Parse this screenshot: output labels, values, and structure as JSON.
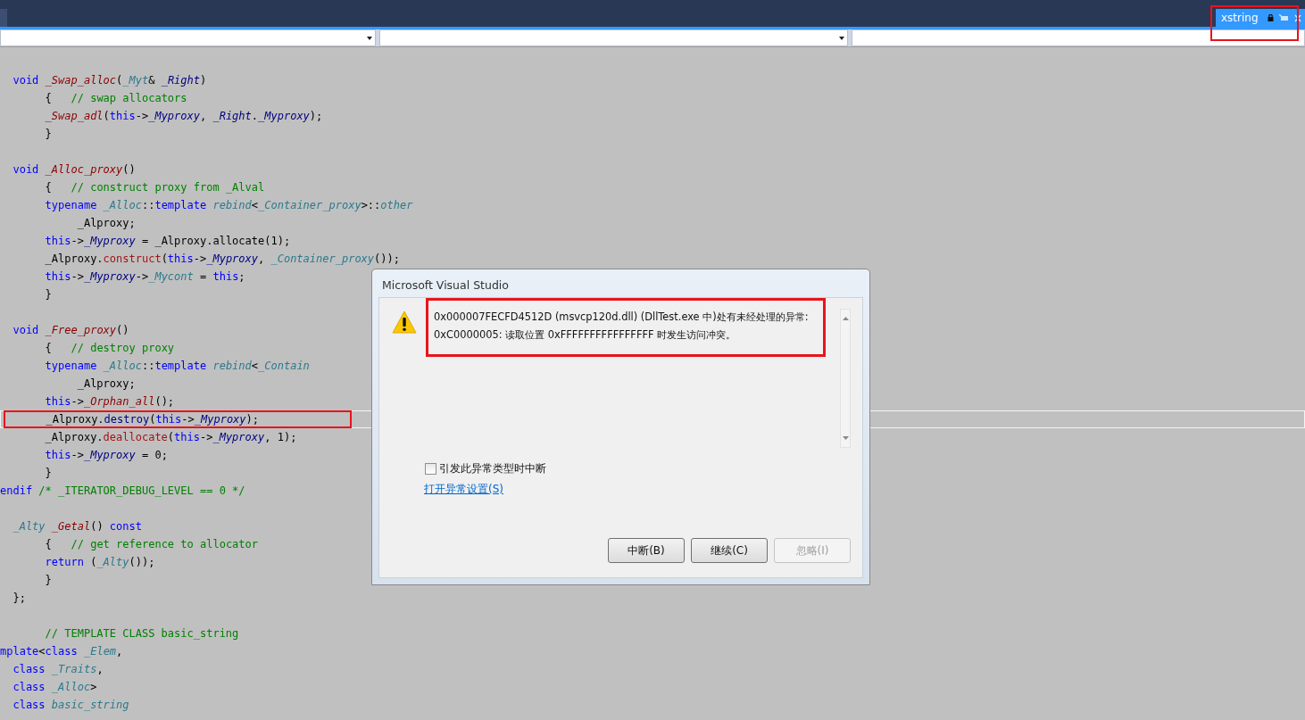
{
  "editor_tab": {
    "title": "xstring",
    "selected": true
  },
  "code_lines": [
    {
      "kind": "blank"
    },
    {
      "kind": "code",
      "tokens": [
        {
          "kind": "keyword",
          "text": "  void "
        },
        {
          "kind": "function",
          "text": "_Swap_alloc"
        },
        {
          "kind": "plain",
          "text": "("
        },
        {
          "kind": "type",
          "text": "_Myt"
        },
        {
          "kind": "plain",
          "text": "& "
        },
        {
          "kind": "field",
          "text": "_Right"
        },
        {
          "kind": "plain",
          "text": ")"
        }
      ]
    },
    {
      "kind": "code",
      "tokens": [
        {
          "kind": "plain",
          "text": "       {   "
        },
        {
          "kind": "comment",
          "text": "// swap allocators"
        }
      ]
    },
    {
      "kind": "code",
      "tokens": [
        {
          "kind": "function",
          "text": "       _Swap_adl"
        },
        {
          "kind": "plain",
          "text": "("
        },
        {
          "kind": "keyword",
          "text": "this"
        },
        {
          "kind": "plain",
          "text": "->"
        },
        {
          "kind": "field",
          "text": "_Myproxy"
        },
        {
          "kind": "plain",
          "text": ", "
        },
        {
          "kind": "field",
          "text": "_Right"
        },
        {
          "kind": "plain",
          "text": "."
        },
        {
          "kind": "field",
          "text": "_Myproxy"
        },
        {
          "kind": "plain",
          "text": ");"
        }
      ]
    },
    {
      "kind": "code",
      "tokens": [
        {
          "kind": "plain",
          "text": "       }"
        }
      ]
    },
    {
      "kind": "blank"
    },
    {
      "kind": "code",
      "tokens": [
        {
          "kind": "keyword",
          "text": "  void "
        },
        {
          "kind": "function",
          "text": "_Alloc_proxy"
        },
        {
          "kind": "plain",
          "text": "()"
        }
      ]
    },
    {
      "kind": "code",
      "tokens": [
        {
          "kind": "plain",
          "text": "       {   "
        },
        {
          "kind": "comment",
          "text": "// construct proxy from _Alval"
        }
      ]
    },
    {
      "kind": "code",
      "tokens": [
        {
          "kind": "keyword",
          "text": "       typename "
        },
        {
          "kind": "type",
          "text": "_Alloc"
        },
        {
          "kind": "plain",
          "text": "::"
        },
        {
          "kind": "keyword",
          "text": "template "
        },
        {
          "kind": "type",
          "text": "rebind"
        },
        {
          "kind": "plain",
          "text": "<"
        },
        {
          "kind": "type",
          "text": "_Container_proxy"
        },
        {
          "kind": "plain",
          "text": ">::"
        },
        {
          "kind": "type",
          "text": "other"
        }
      ]
    },
    {
      "kind": "code",
      "tokens": [
        {
          "kind": "plain",
          "text": "            _Alproxy;"
        }
      ]
    },
    {
      "kind": "code",
      "tokens": [
        {
          "kind": "keyword",
          "text": "       this"
        },
        {
          "kind": "plain",
          "text": "->"
        },
        {
          "kind": "field",
          "text": "_Myproxy"
        },
        {
          "kind": "plain",
          "text": " = _Alproxy.allocate(1);"
        }
      ]
    },
    {
      "kind": "code",
      "tokens": [
        {
          "kind": "plain",
          "text": "       _Alproxy."
        },
        {
          "kind": "method",
          "text": "construct"
        },
        {
          "kind": "plain",
          "text": "("
        },
        {
          "kind": "keyword",
          "text": "this"
        },
        {
          "kind": "plain",
          "text": "->"
        },
        {
          "kind": "field",
          "text": "_Myproxy"
        },
        {
          "kind": "plain",
          "text": ", "
        },
        {
          "kind": "type",
          "text": "_Container_proxy"
        },
        {
          "kind": "plain",
          "text": "());"
        }
      ]
    },
    {
      "kind": "code",
      "tokens": [
        {
          "kind": "keyword",
          "text": "       this"
        },
        {
          "kind": "plain",
          "text": "->"
        },
        {
          "kind": "field",
          "text": "_Myproxy"
        },
        {
          "kind": "plain",
          "text": "->"
        },
        {
          "kind": "type",
          "text": "_Mycont"
        },
        {
          "kind": "plain",
          "text": " = "
        },
        {
          "kind": "keyword",
          "text": "this"
        },
        {
          "kind": "plain",
          "text": ";"
        }
      ]
    },
    {
      "kind": "code",
      "tokens": [
        {
          "kind": "plain",
          "text": "       }"
        }
      ]
    },
    {
      "kind": "blank"
    },
    {
      "kind": "code",
      "tokens": [
        {
          "kind": "keyword",
          "text": "  void "
        },
        {
          "kind": "function",
          "text": "_Free_proxy"
        },
        {
          "kind": "plain",
          "text": "()"
        }
      ]
    },
    {
      "kind": "code",
      "tokens": [
        {
          "kind": "plain",
          "text": "       {   "
        },
        {
          "kind": "comment",
          "text": "// destroy proxy"
        }
      ]
    },
    {
      "kind": "code",
      "tokens": [
        {
          "kind": "keyword",
          "text": "       typename "
        },
        {
          "kind": "type",
          "text": "_Alloc"
        },
        {
          "kind": "plain",
          "text": "::"
        },
        {
          "kind": "keyword",
          "text": "template "
        },
        {
          "kind": "type",
          "text": "rebind"
        },
        {
          "kind": "plain",
          "text": "<"
        },
        {
          "kind": "type",
          "text": "_Contain"
        }
      ]
    },
    {
      "kind": "code",
      "tokens": [
        {
          "kind": "plain",
          "text": "            _Alproxy;"
        }
      ]
    },
    {
      "kind": "code",
      "tokens": [
        {
          "kind": "keyword",
          "text": "       this"
        },
        {
          "kind": "plain",
          "text": "->"
        },
        {
          "kind": "function",
          "text": "_Orphan_all"
        },
        {
          "kind": "plain",
          "text": "();"
        }
      ]
    },
    {
      "kind": "current",
      "tokens": [
        {
          "kind": "plain",
          "text": "       _Alproxy."
        },
        {
          "kind": "call",
          "text": "destroy"
        },
        {
          "kind": "plain",
          "text": "("
        },
        {
          "kind": "keyword",
          "text": "this"
        },
        {
          "kind": "plain",
          "text": "->"
        },
        {
          "kind": "field",
          "text": "_Myproxy"
        },
        {
          "kind": "plain",
          "text": ");"
        }
      ]
    },
    {
      "kind": "code",
      "tokens": [
        {
          "kind": "plain",
          "text": "       _Alproxy."
        },
        {
          "kind": "method",
          "text": "deallocate"
        },
        {
          "kind": "plain",
          "text": "("
        },
        {
          "kind": "keyword",
          "text": "this"
        },
        {
          "kind": "plain",
          "text": "->"
        },
        {
          "kind": "field",
          "text": "_Myproxy"
        },
        {
          "kind": "plain",
          "text": ", 1);"
        }
      ]
    },
    {
      "kind": "code",
      "tokens": [
        {
          "kind": "keyword",
          "text": "       this"
        },
        {
          "kind": "plain",
          "text": "->"
        },
        {
          "kind": "field",
          "text": "_Myproxy"
        },
        {
          "kind": "plain",
          "text": " = 0;"
        }
      ]
    },
    {
      "kind": "code",
      "tokens": [
        {
          "kind": "plain",
          "text": "       }"
        }
      ]
    },
    {
      "kind": "code",
      "tokens": [
        {
          "kind": "keyword",
          "text": "endif "
        },
        {
          "kind": "comment",
          "text": "/* _ITERATOR_DEBUG_LEVEL == 0 */"
        }
      ]
    },
    {
      "kind": "blank"
    },
    {
      "kind": "code",
      "tokens": [
        {
          "kind": "type",
          "text": "  _Alty "
        },
        {
          "kind": "function",
          "text": "_Getal"
        },
        {
          "kind": "plain",
          "text": "() "
        },
        {
          "kind": "keyword",
          "text": "const"
        }
      ]
    },
    {
      "kind": "code",
      "tokens": [
        {
          "kind": "plain",
          "text": "       {   "
        },
        {
          "kind": "comment",
          "text": "// get reference to allocator"
        }
      ]
    },
    {
      "kind": "code",
      "tokens": [
        {
          "kind": "keyword",
          "text": "       return"
        },
        {
          "kind": "plain",
          "text": " ("
        },
        {
          "kind": "type",
          "text": "_Alty"
        },
        {
          "kind": "plain",
          "text": "());"
        }
      ]
    },
    {
      "kind": "code",
      "tokens": [
        {
          "kind": "plain",
          "text": "       }"
        }
      ]
    },
    {
      "kind": "code",
      "tokens": [
        {
          "kind": "plain",
          "text": "  };"
        }
      ]
    },
    {
      "kind": "blank"
    },
    {
      "kind": "code",
      "tokens": [
        {
          "kind": "comment",
          "text": "       // TEMPLATE CLASS basic_string"
        }
      ]
    },
    {
      "kind": "code",
      "tokens": [
        {
          "kind": "keyword",
          "text": "mplate"
        },
        {
          "kind": "plain",
          "text": "<"
        },
        {
          "kind": "keyword",
          "text": "class "
        },
        {
          "kind": "type",
          "text": "_Elem"
        },
        {
          "kind": "plain",
          "text": ","
        }
      ]
    },
    {
      "kind": "code",
      "tokens": [
        {
          "kind": "keyword",
          "text": "  class "
        },
        {
          "kind": "type",
          "text": "_Traits"
        },
        {
          "kind": "plain",
          "text": ","
        }
      ]
    },
    {
      "kind": "code",
      "tokens": [
        {
          "kind": "keyword",
          "text": "  class "
        },
        {
          "kind": "type",
          "text": "_Alloc"
        },
        {
          "kind": "plain",
          "text": ">"
        }
      ]
    },
    {
      "kind": "code",
      "tokens": [
        {
          "kind": "keyword",
          "text": "  class "
        },
        {
          "kind": "type",
          "text": "basic_string"
        }
      ]
    }
  ],
  "dialog": {
    "title": "Microsoft Visual Studio",
    "message_lines": [
      "0x000007FECFD4512D (msvcp120d.dll) (DllTest.exe 中)处有未经处理的异常:",
      "0xC0000005: 读取位置 0xFFFFFFFFFFFFFFFF 时发生访问冲突。"
    ],
    "checkbox": {
      "label": "引发此异常类型时中断",
      "checked": false
    },
    "link": "打开异常设置(S)",
    "buttons": [
      {
        "label": "中断(B)",
        "disabled": false
      },
      {
        "label": "继续(C)",
        "disabled": false
      },
      {
        "label": "忽略(I)",
        "disabled": true
      }
    ]
  }
}
